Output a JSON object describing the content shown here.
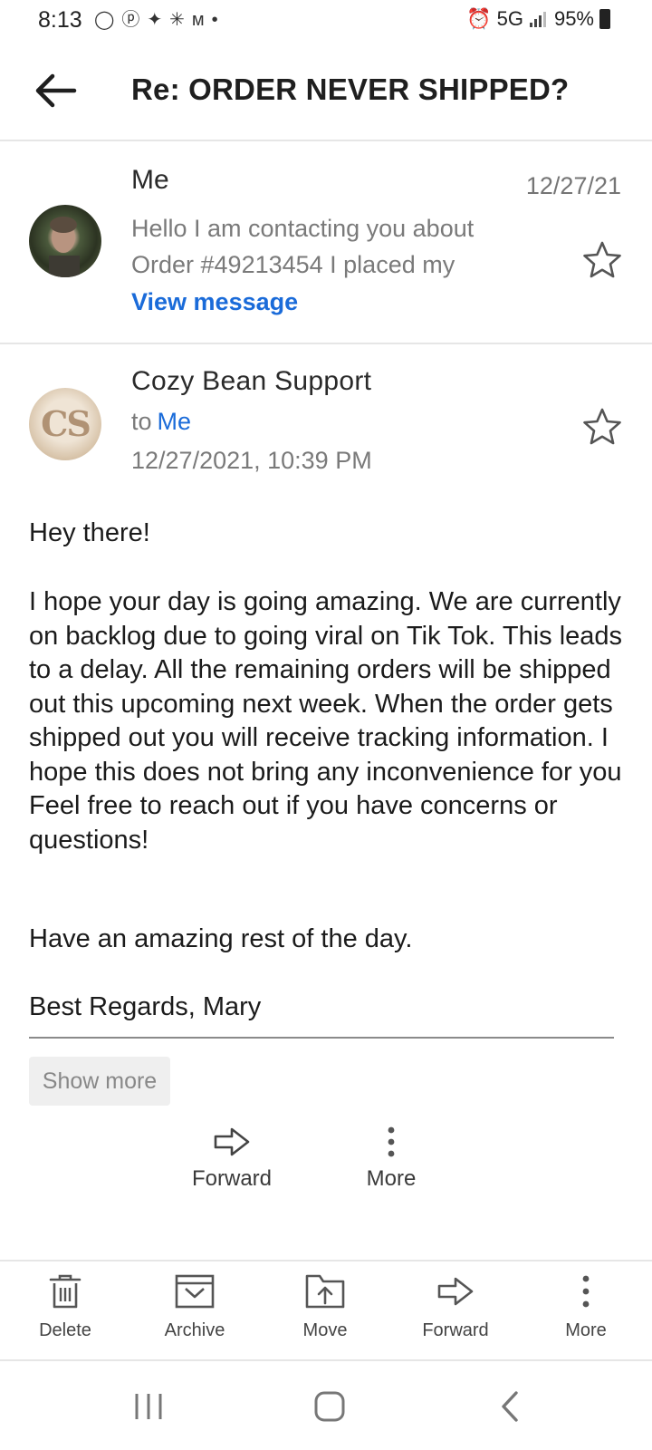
{
  "status_bar": {
    "time": "8:13",
    "network": "5G",
    "battery": "95%"
  },
  "header": {
    "title": "Re: ORDER NEVER SHIPPED?"
  },
  "messages": [
    {
      "sender": "Me",
      "date": "12/27/21",
      "preview_line1": "Hello I am contacting you about",
      "preview_line2": "Order #49213454 I placed my",
      "view_label": "View message"
    },
    {
      "sender": "Cozy Bean Support",
      "avatar_initials": "CS",
      "to_prefix": "to",
      "to_name": "Me",
      "datetime": "12/27/2021, 10:39 PM",
      "greeting": "Hey there!",
      "paragraph": "I hope your day is going amazing. We are currently on backlog due to going viral on Tik Tok. This leads to a delay. All the remaining orders will be shipped out this upcoming next week. When the order gets shipped out you will receive tracking information. I hope this does not bring any inconvenience for you Feel free to reach out if you have concerns or questions!",
      "closing": "Have an amazing rest of the day.",
      "signoff": "Best Regards, Mary",
      "show_more_label": "Show more"
    }
  ],
  "inline_actions": {
    "forward_label": "Forward",
    "more_label": "More"
  },
  "toolbar": {
    "delete_label": "Delete",
    "archive_label": "Archive",
    "move_label": "Move",
    "forward_label": "Forward",
    "more_label": "More"
  },
  "colors": {
    "accent": "#1a6bd9",
    "muted_text": "#7a7a7a",
    "divider": "#e6e6e6"
  }
}
